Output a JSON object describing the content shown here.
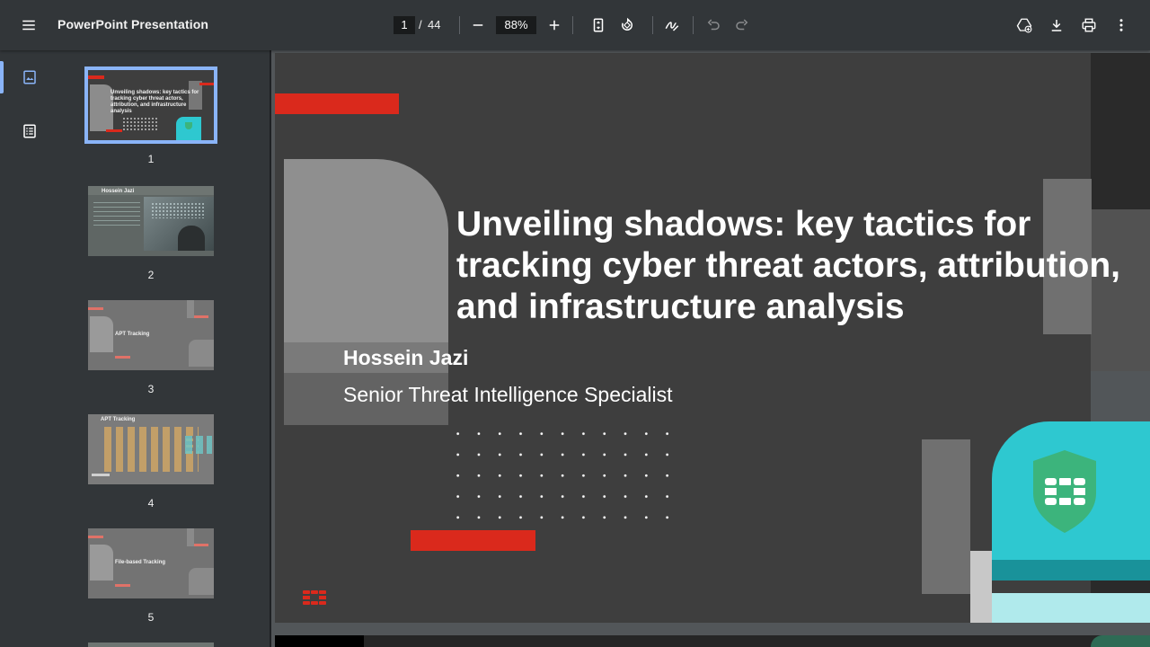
{
  "app": {
    "title": "PowerPoint Presentation"
  },
  "toolbar": {
    "menu_icon": "hamburger-menu-icon",
    "page_current": "1",
    "page_separator": "/",
    "page_total": "44",
    "zoom": "88%",
    "icons": [
      "zoom-out-icon",
      "zoom-in-icon",
      "fit-to-page-icon",
      "rotate-icon",
      "draw-icon",
      "undo-icon",
      "redo-icon",
      "save-to-drive-icon",
      "download-icon",
      "print-icon",
      "more-vert-icon"
    ]
  },
  "sidebar": {
    "icons": [
      "thumbnails-icon",
      "outline-icon"
    ]
  },
  "thumbnails": [
    {
      "number": "1",
      "selected": true
    },
    {
      "number": "2",
      "heading": "Hossein Jazi"
    },
    {
      "number": "3",
      "heading": "APT Tracking"
    },
    {
      "number": "4",
      "heading": "APT Tracking"
    },
    {
      "number": "5",
      "heading": "File-based Tracking"
    }
  ],
  "slide": {
    "title_line1": "Unveiling shadows: key tactics for",
    "title_line2": "tracking cyber threat actors, attribution,",
    "title_line3": "and infrastructure analysis",
    "presenter_name": "Hossein Jazi",
    "presenter_role": "Senior Threat Intelligence Specialist",
    "accent_red": "#da291c",
    "accent_teal": "#2ec8d0",
    "shield_green": "#3cb47c"
  }
}
